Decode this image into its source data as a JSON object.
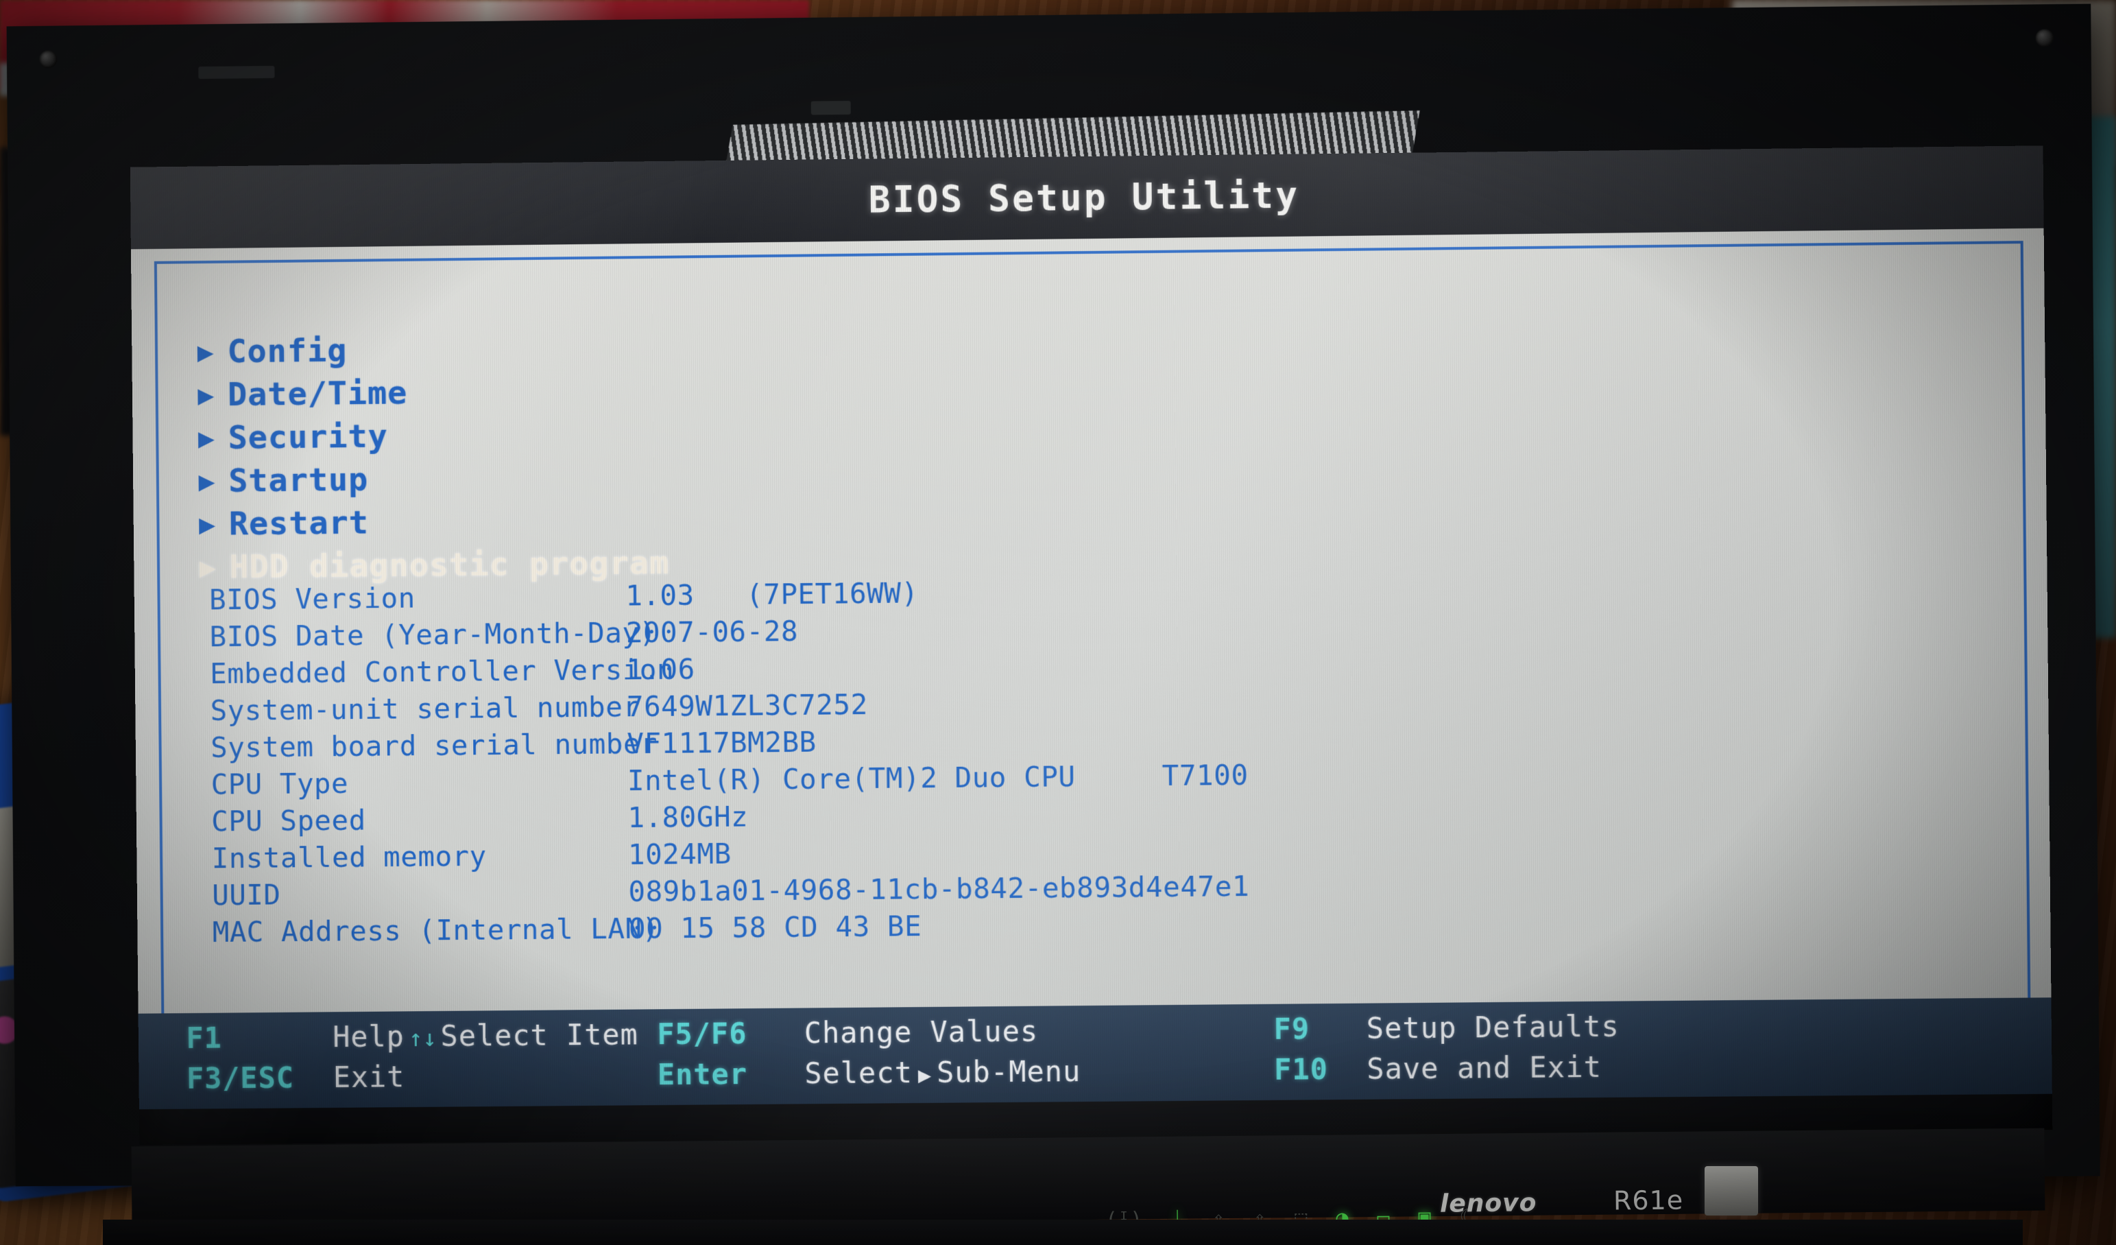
{
  "screen": {
    "title": "BIOS Setup Utility",
    "menu": [
      {
        "arrow": "▶",
        "label": "Config",
        "selected": false
      },
      {
        "arrow": "▶",
        "label": "Date/Time",
        "selected": false
      },
      {
        "arrow": "▶",
        "label": "Security",
        "selected": false
      },
      {
        "arrow": "▶",
        "label": "Startup",
        "selected": false
      },
      {
        "arrow": "▶",
        "label": "Restart",
        "selected": false
      },
      {
        "arrow": "▶",
        "label": "HDD diagnostic program",
        "selected": true
      }
    ],
    "info": [
      {
        "label": "BIOS Version",
        "value": "1.03   (7PET16WW)"
      },
      {
        "label": "BIOS Date (Year-Month-Day)",
        "value": "2007-06-28"
      },
      {
        "label": "Embedded Controller Version",
        "value": "1.06"
      },
      {
        "label": "System-unit serial number",
        "value": "7649W1ZL3C7252"
      },
      {
        "label": "System board serial number",
        "value": "VF1117BM2BB"
      },
      {
        "label": "CPU Type",
        "value": "Intel(R) Core(TM)2 Duo CPU     T7100"
      },
      {
        "label": "CPU Speed",
        "value": "1.80GHz"
      },
      {
        "label": "Installed memory",
        "value": "1024MB"
      },
      {
        "label": "UUID",
        "value": "089b1a01-4968-11cb-b842-eb893d4e47e1"
      },
      {
        "label": "MAC Address (Internal LAN)",
        "value": "00 15 58 CD 43 BE"
      }
    ],
    "help_bar": {
      "col1": [
        {
          "key": "F1",
          "desc": "Help",
          "arrows": "↑↓",
          "desc2": "Select Item"
        },
        {
          "key": "F3/ESC",
          "desc": "Exit",
          "arrows": "",
          "desc2": ""
        }
      ],
      "col2": [
        {
          "key": "F5/F6",
          "desc": "Change Values",
          "submenu": false,
          "desc2": ""
        },
        {
          "key": "Enter",
          "desc": "Select",
          "submenu": true,
          "desc2": "Sub-Menu",
          "submenu_arrow": "▶"
        }
      ],
      "col3": [
        {
          "key": "F9",
          "desc": "Setup Defaults"
        },
        {
          "key": "F10",
          "desc": "Save and Exit"
        }
      ]
    }
  },
  "hardware": {
    "brand": "lenovo",
    "model": "R61e",
    "indicators": [
      {
        "name": "wireless-indicator",
        "glyph": "(ᴵ)",
        "state": "off"
      },
      {
        "name": "bluetooth-indicator",
        "glyph": "ᛦ",
        "state": "on"
      },
      {
        "name": "caps-lock-indicator",
        "glyph": "⇧",
        "state": "off"
      },
      {
        "name": "num-lock-indicator",
        "glyph": "⇧",
        "state": "off"
      },
      {
        "name": "drive-access-indicator",
        "glyph": "⬚",
        "state": "off"
      },
      {
        "name": "power-on-indicator",
        "glyph": "◑",
        "state": "on"
      },
      {
        "name": "battery-indicator",
        "glyph": "▭",
        "state": "on"
      },
      {
        "name": "ac-power-indicator",
        "glyph": "▣",
        "state": "on"
      },
      {
        "name": "sleep-indicator",
        "glyph": "☾",
        "state": "off"
      }
    ]
  },
  "colors": {
    "bios_blue": "#2065c4",
    "menu_blue": "#1b5fc0",
    "selected_cream": "#f2ece0",
    "frame_blue": "#3370c9",
    "helpbar_bg": "#233a52",
    "help_key_cyan": "#59d6d6",
    "help_desc_white": "#e8ebef",
    "screen_bg": "#d8dad7",
    "title_bar_bg": "#2a2c31",
    "led_green": "#4bdc4b"
  }
}
